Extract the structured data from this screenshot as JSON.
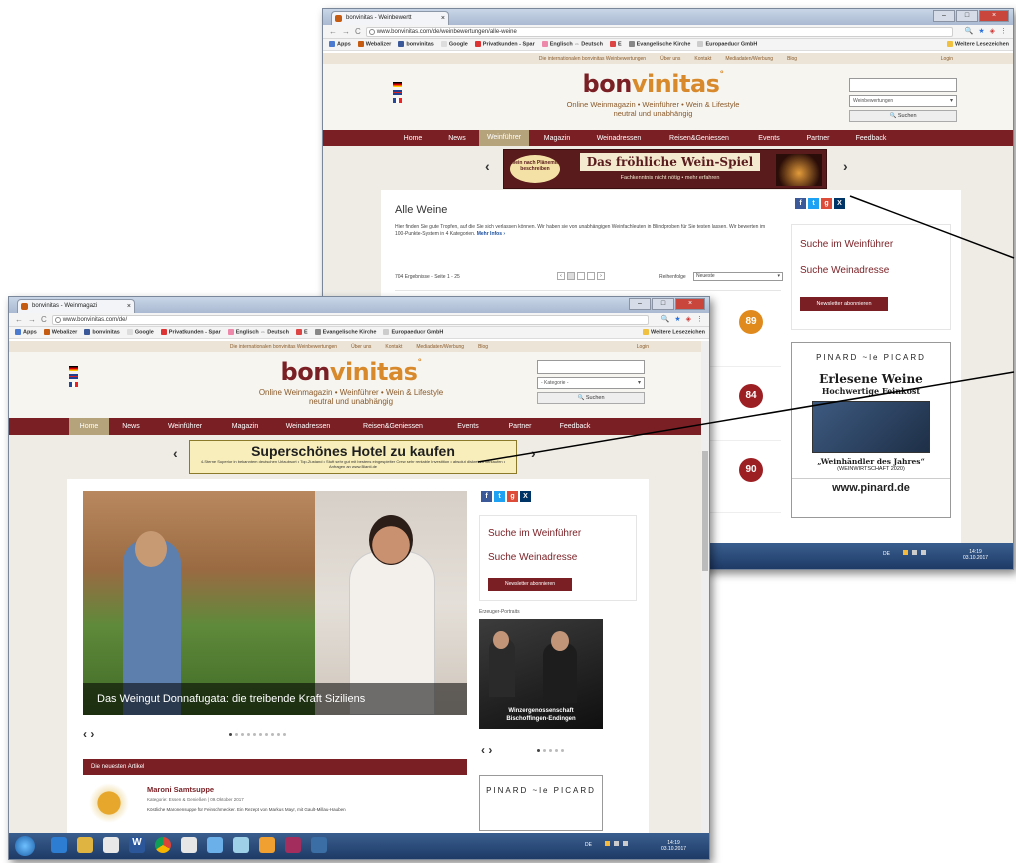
{
  "colors": {
    "brand_dark": "#7a1f24",
    "brand_accent": "#d8892c",
    "menu_active": "#b5a37b"
  },
  "back_window": {
    "tab_title": "bonvinitas - Weinbewertt",
    "url": "www.bonvinitas.com/de/weinbewertungen/alle-weine",
    "bookmarks": [
      "Apps",
      "Webalizer",
      "bonvinitas",
      "Google",
      "Privatkunden - Spar",
      "Englisch ⇔ Deutsch",
      "E",
      "Evangelische Kirche",
      "Europaeducr GmbH",
      "Weitere Lesezeichen"
    ],
    "topstrip": [
      "Die internationalen bonvinitas Weinbewertungen",
      "Über uns",
      "Kontakt",
      "Mediadaten/Werbung",
      "Blog"
    ],
    "login": "Login",
    "logo_bon": "bon",
    "logo_vin": "vinitas",
    "tagline1": "Online Weinmagazin • Weinführer • Wein & Lifestyle",
    "tagline2": "neutral und unabhängig",
    "search_select": "Weinbewertungen",
    "search_button": "Suchen",
    "menu": [
      "Home",
      "News",
      "Weinführer",
      "Magazin",
      "Weinadressen",
      "Reisen&Geniessen",
      "Events",
      "Partner",
      "Feedback"
    ],
    "active_menu": "Weinführer",
    "banner_badge": "Wein nach Plänemitt beschreiben",
    "banner_title": "Das fröhliche Wein-Spiel",
    "banner_sub": "Fachkenntnis nicht nötig • mehr erfahren",
    "page_title": "Alle Weine",
    "intro": "Hier finden Sie gute Tropfen, auf die Sie sich verlassen können. Wir haben sie von unabhängigen Weinfachleuten in Blindproben für Sie testen lassen. Wir bewerten im 100-Punkte-System in 4 Kategorien.",
    "more_info": "Mehr Infos ›",
    "results": "704 Ergebnisse - Seite 1 - 25",
    "order_label": "Reihenfolge",
    "order_value": "Neueste",
    "sidebar_link1": "Suche im Weinführer",
    "sidebar_link2": "Suche Weinadresse",
    "newsletter": "Newsletter abonnieren",
    "ad_brand": "PINARD ~le PICARD",
    "ad_line1": "Erlesene Weine",
    "ad_line2": "Hochwertige Feinkost",
    "ad_line3": "„Weinhändler des Jahres“",
    "ad_line4": "(WEINWIRTSCHAFT 2020)",
    "ad_url": "www.pinard.de",
    "scores": [
      "89",
      "84",
      "90"
    ],
    "clock_time": "14:19",
    "clock_date": "03.10.2017",
    "tray_lang": "DE"
  },
  "front_window": {
    "tab_title": "bonvinitas - Weinmagazi",
    "url": "www.bonvinitas.com/de/",
    "bookmarks": [
      "Apps",
      "Webalizer",
      "bonvinitas",
      "Google",
      "Privatkunden - Spar",
      "Englisch ⇔ Deutsch",
      "E",
      "Evangelische Kirche",
      "Europaeducr GmbH",
      "Weitere Lesezeichen"
    ],
    "topstrip": [
      "Die internationalen bonvinitas Weinbewertungen",
      "Über uns",
      "Kontakt",
      "Mediadaten/Werbung",
      "Blog"
    ],
    "login": "Login",
    "logo_bon": "bon",
    "logo_vin": "vinitas",
    "tagline1": "Online Weinmagazin • Weinführer • Wein & Lifestyle",
    "tagline2": "neutral und unabhängig",
    "search_select": "- Kategorie -",
    "search_button": "Suchen",
    "menu": [
      "Home",
      "News",
      "Weinführer",
      "Magazin",
      "Weinadressen",
      "Reisen&Geniessen",
      "Events",
      "Partner",
      "Feedback"
    ],
    "active_menu": "Home",
    "banner_title": "Superschönes Hotel zu kaufen",
    "banner_sub": "4-Sterne Superior in bekanntem deutschen Urlaubsort • Top-Zustand • Stuft sehr gut mit bestens eingespielter Crew sehr rentable Investition • absolut diskret zu verkaufen • Anfragen an www.Bianti.de",
    "hero_caption": "Das Weingut Donnafugata: die treibende Kraft Siziliens",
    "sidebar_link1": "Suche im Weinführer",
    "sidebar_link2": "Suche Weinadresse",
    "newsletter": "Newsletter abonnieren",
    "portrait_label": "Erzeuger-Portraits",
    "portrait_caption1": "Winzergenossenschaft",
    "portrait_caption2": "Bischoffingen-Endingen",
    "latest_header": "Die neuesten Artikel",
    "article_title": "Maroni Samtsuppe",
    "article_meta": "Kategorie: Essen & Genießen | 09.Oktober 2017",
    "article_text": "Köstliche Maronensuppe für Feinschmecker. Ein Rezept von Markus Mayr, mit Gault-Millau-Hauben",
    "ad_brand": "PINARD ~le PICARD",
    "clock_time": "14:19",
    "clock_date": "03.10.2017",
    "tray_lang": "DE"
  }
}
